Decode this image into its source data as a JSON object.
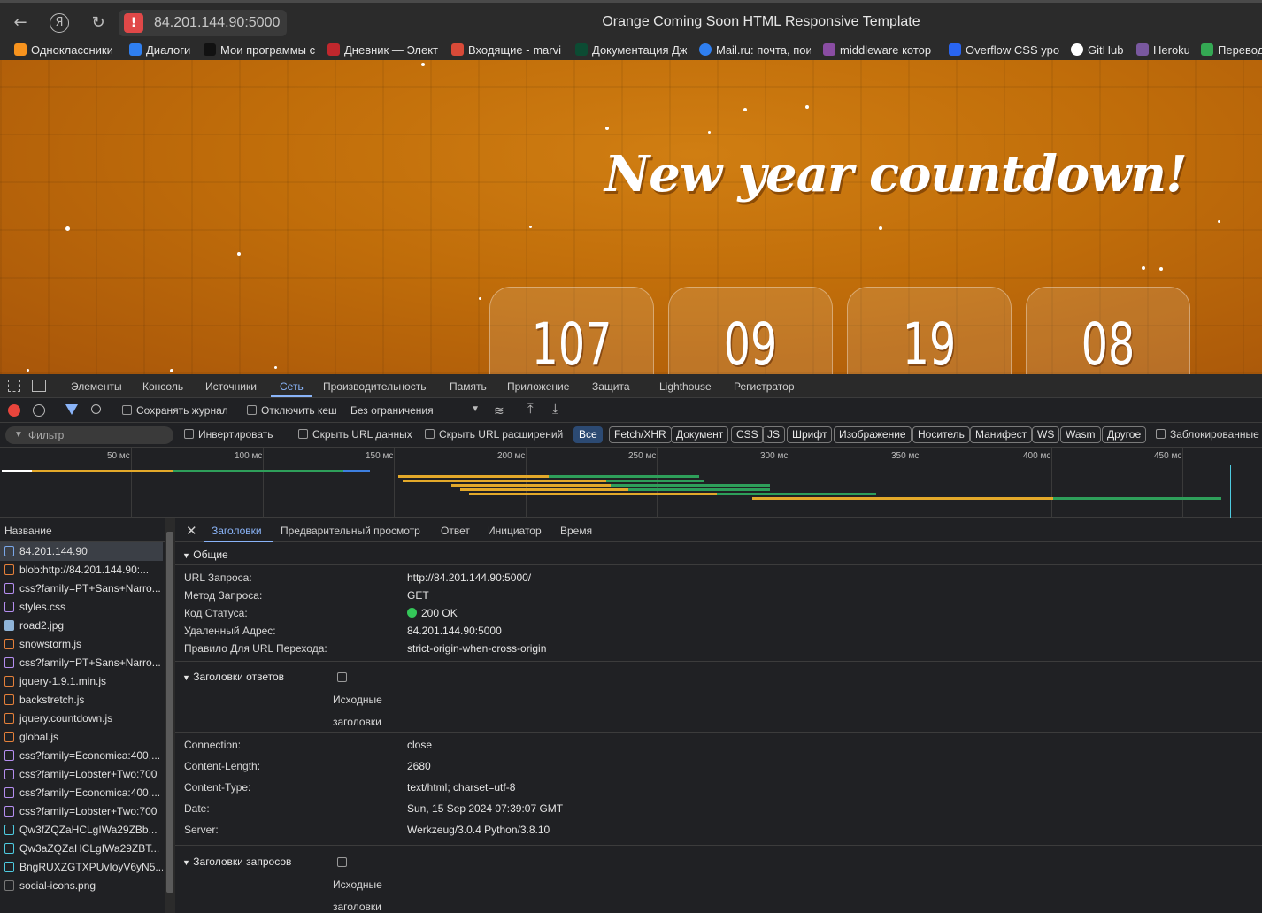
{
  "browser": {
    "url": "84.201.144.90:5000",
    "title": "Orange Coming Soon HTML Responsive Template",
    "bookmarks": [
      {
        "label": "Одноклассники",
        "color": "#f7931e"
      },
      {
        "label": "Диалоги",
        "color": "#2f7ff0"
      },
      {
        "label": "Мои программы с",
        "color": "#222222"
      },
      {
        "label": "Дневник — Элект",
        "color": "#c0272d"
      },
      {
        "label": "Входящие - marvi",
        "color": "#d84a38"
      },
      {
        "label": "Документация Дж",
        "color": "#0c4b33"
      },
      {
        "label": "Mail.ru: почта, пои",
        "color": "#2f7ff0"
      },
      {
        "label": "middleware котор",
        "color": "#8a4da3"
      },
      {
        "label": "Overflow CSS уро",
        "color": "#2965f1"
      },
      {
        "label": "GitHub",
        "color": "#ffffff"
      },
      {
        "label": "Heroku",
        "color": "#79589f"
      },
      {
        "label": "Перевод",
        "color": "#34a853"
      }
    ]
  },
  "page": {
    "headline": "New year countdown!",
    "countdown": [
      "107",
      "09",
      "19",
      "08"
    ]
  },
  "devtools": {
    "tabs": [
      "Элементы",
      "Консоль",
      "Источники",
      "Сеть",
      "Производительность",
      "Память",
      "Приложение",
      "Защита",
      "Lighthouse",
      "Регистратор"
    ],
    "active_tab": "Сеть",
    "toolbar": {
      "preserve_log": "Сохранять журнал",
      "disable_cache": "Отключить кеш",
      "throttling": "Без ограничения"
    },
    "filter": {
      "placeholder": "Фильтр",
      "invert": "Инвертировать",
      "hide_data_urls": "Скрыть URL данных",
      "hide_ext_urls": "Скрыть URL расширений",
      "types": [
        "Все",
        "Fetch/XHR",
        "Документ",
        "CSS",
        "JS",
        "Шрифт",
        "Изображение",
        "Носитель",
        "Манифест",
        "WS",
        "Wasm",
        "Другое"
      ],
      "blocked": "Заблокированные"
    },
    "timeline_ticks": [
      "50 мс",
      "100 мс",
      "150 мс",
      "200 мс",
      "250 мс",
      "300 мс",
      "350 мс",
      "400 мс",
      "450 мс"
    ],
    "request_list": {
      "header": "Название",
      "rows": [
        {
          "name": "84.201.144.90",
          "type": "doc"
        },
        {
          "name": "blob:http://84.201.144.90:...",
          "type": "js"
        },
        {
          "name": "css?family=PT+Sans+Narro...",
          "type": "css"
        },
        {
          "name": "styles.css",
          "type": "css"
        },
        {
          "name": "road2.jpg",
          "type": "img"
        },
        {
          "name": "snowstorm.js",
          "type": "js"
        },
        {
          "name": "css?family=PT+Sans+Narro...",
          "type": "css"
        },
        {
          "name": "jquery-1.9.1.min.js",
          "type": "js"
        },
        {
          "name": "backstretch.js",
          "type": "js"
        },
        {
          "name": "jquery.countdown.js",
          "type": "js"
        },
        {
          "name": "global.js",
          "type": "js"
        },
        {
          "name": "css?family=Economica:400,...",
          "type": "css"
        },
        {
          "name": "css?family=Lobster+Two:700",
          "type": "css"
        },
        {
          "name": "css?family=Economica:400,...",
          "type": "css"
        },
        {
          "name": "css?family=Lobster+Two:700",
          "type": "css"
        },
        {
          "name": "Qw3fZQZaHCLgIWa29ZBb...",
          "type": "font"
        },
        {
          "name": "Qw3aZQZaHCLgIWa29ZBT...",
          "type": "font"
        },
        {
          "name": "BngRUXZGTXPUvIoyV6yN5...",
          "type": "font"
        },
        {
          "name": "social-icons.png",
          "type": "other"
        }
      ]
    },
    "detail": {
      "tabs": [
        "Заголовки",
        "Предварительный просмотр",
        "Ответ",
        "Инициатор",
        "Время"
      ],
      "general_title": "Общие",
      "general": [
        {
          "k": "URL Запроса:",
          "v": "http://84.201.144.90:5000/"
        },
        {
          "k": "Метод Запроса:",
          "v": "GET"
        },
        {
          "k": "Код Статуса:",
          "v": "200 OK"
        },
        {
          "k": "Удаленный Адрес:",
          "v": "84.201.144.90:5000"
        },
        {
          "k": "Правило Для URL Перехода:",
          "v": "strict-origin-when-cross-origin"
        }
      ],
      "response_headers_title": "Заголовки ответов",
      "raw_label_1": "Исходные",
      "raw_label_2": "заголовки",
      "response_headers": [
        {
          "k": "Connection:",
          "v": "close"
        },
        {
          "k": "Content-Length:",
          "v": "2680"
        },
        {
          "k": "Content-Type:",
          "v": "text/html; charset=utf-8"
        },
        {
          "k": "Date:",
          "v": "Sun, 15 Sep 2024 07:39:07 GMT"
        },
        {
          "k": "Server:",
          "v": "Werkzeug/3.0.4 Python/3.8.10"
        }
      ],
      "request_headers_title": "Заголовки запросов"
    }
  }
}
